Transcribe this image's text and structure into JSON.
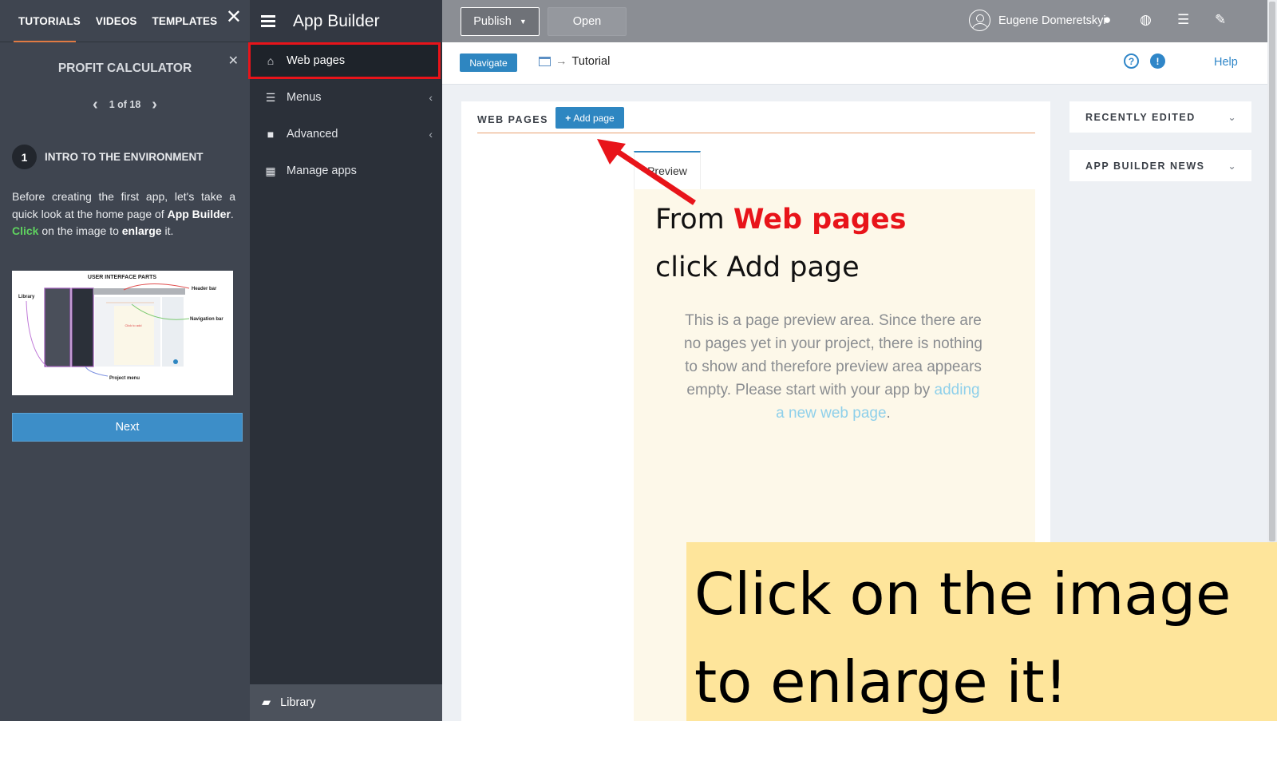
{
  "tutorial": {
    "tabs": [
      "TUTORIALS",
      "VIDEOS",
      "TEMPLATES"
    ],
    "close_icon": "close-icon",
    "title": "PROFIT CALCULATOR",
    "pager": "1 of 18",
    "step_number": "1",
    "step_title": "INTRO TO THE ENVIRONMENT",
    "text_intro": "Before creating the first app, let's take a quick look at the home page of",
    "text_app": "App Builder",
    "text_period": ".",
    "text_click": "Click",
    "text_on": " on the image to ",
    "text_enlarge": "enlarge",
    "text_it": " it.",
    "thumb": {
      "title": "USER INTERFACE PARTS",
      "label_library": "Library",
      "label_header": "Header bar",
      "label_navigation": "Navigation bar",
      "label_project": "Project menu",
      "label_click": "Click to add"
    },
    "next_label": "Next"
  },
  "nav": {
    "app_title": "App Builder",
    "items": [
      {
        "label": "Web pages",
        "icon": "home-icon"
      },
      {
        "label": "Menus",
        "icon": "menu-icon"
      },
      {
        "label": "Advanced",
        "icon": "lock-icon"
      },
      {
        "label": "Manage apps",
        "icon": "grid-icon"
      }
    ],
    "library_label": "Library"
  },
  "topbar": {
    "publish_label": "Publish",
    "open_label": "Open",
    "user_name": "Eugene Domeretskyi",
    "icons": [
      "info-icon",
      "globe-icon",
      "list-icon",
      "wrench-icon"
    ]
  },
  "subbar": {
    "navigate_label": "Navigate",
    "breadcrumb": "Tutorial",
    "help_label": "Help"
  },
  "main": {
    "card_title": "WEB PAGES",
    "add_page_label": "Add page",
    "preview_tab": "Preview",
    "annotation_from": "From ",
    "annotation_webpages": "Web pages",
    "annotation_click": "click ",
    "annotation_addpage": "Add page",
    "preview_msg": "This is a page preview area. Since there are no pages yet in your project, there is nothing to show and therefore preview area appears empty. Please start with your app by ",
    "preview_link": "adding a new web page",
    "preview_end": ".",
    "side_cards": [
      "RECENTLY EDITED",
      "APP BUILDER NEWS"
    ]
  },
  "overlay": {
    "line1": "Click on the image",
    "line2": "to enlarge it!"
  },
  "colors": {
    "accent": "#2e86c1",
    "highlight_red": "#e8141a",
    "note_bg": "#fee59b",
    "tutorial_bg": "#3f4550",
    "nav_bg": "#2b3039"
  }
}
